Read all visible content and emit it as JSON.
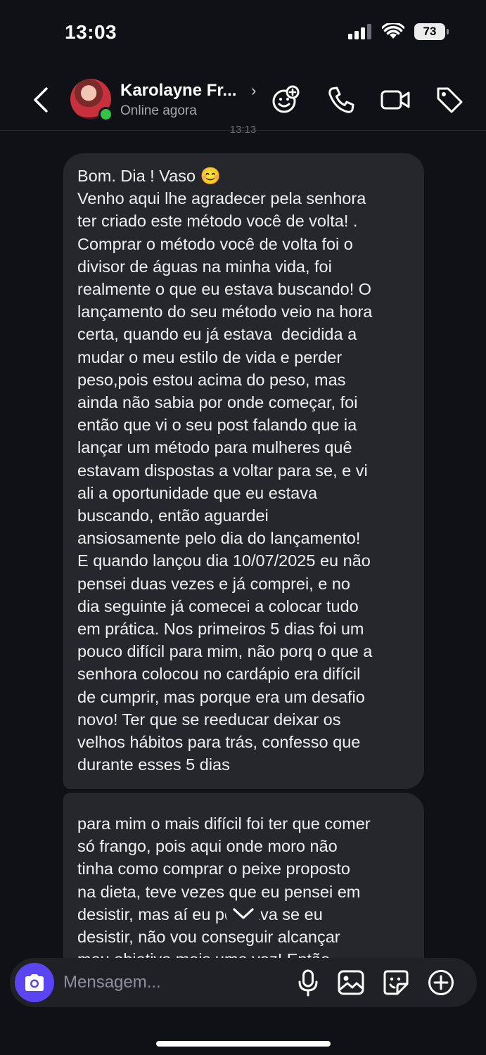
{
  "status_bar": {
    "time": "13:03",
    "battery": "73"
  },
  "header": {
    "contact_name": "Karolayne Fr...",
    "contact_status": "Online agora",
    "timestamp_peek": "13:13"
  },
  "messages": [
    {
      "text": "Bom. Dia ! Vaso 😊\nVenho aqui lhe agradecer pela senhora\nter criado este método você de volta! .\nComprar o método você de volta foi o\ndivisor de águas na minha vida, foi\nrealmente o que eu estava buscando! O\nlançamento do seu método veio na hora\ncerta, quando eu já estava  decidida a\nmudar o meu estilo de vida e perder\npeso,pois estou acima do peso, mas\nainda não sabia por onde começar, foi\nentão que vi o seu post falando que ia\nlançar um método para mulheres quê\nestavam dispostas a voltar para se, e vi\nali a oportunidade que eu estava\nbuscando, então aguardei\nansiosamente pelo dia do lançamento!\nE quando lançou dia 10/07/2025 eu não\npensei duas vezes e já comprei, e no\ndia seguinte já comecei a colocar tudo\nem prática. Nos primeiros 5 dias foi um\npouco difícil para mim, não porq o que a\nsenhora colocou no cardápio era difícil\nde cumprir, mas porque era um desafio\nnovo! Ter que se reeducar deixar os\nvelhos hábitos para trás, confesso que\ndurante esses 5 dias"
    },
    {
      "text": "para mim o mais difícil foi ter que comer\nsó frango, pois aqui onde moro não\ntinha como comprar o peixe proposto\nna dieta, teve vezes que eu pensei em\ndesistir, mas aí eu pensava se eu\ndesistir, não vou conseguir alcançar\nmeu objetivo,mais uma vez! Então"
    }
  ],
  "composer": {
    "placeholder": "Mensagem..."
  },
  "icons": {
    "back": "chevron-left-icon",
    "header_actions": [
      "sticker-add-icon",
      "phone-icon",
      "video-camera-icon",
      "tag-icon"
    ],
    "composer_actions": [
      "microphone-icon",
      "image-icon",
      "sticker-icon",
      "plus-circle-icon"
    ]
  },
  "colors": {
    "accent": "#5b45f2",
    "online": "#31c447",
    "bubble": "#25272c",
    "background": "#0f1116"
  }
}
